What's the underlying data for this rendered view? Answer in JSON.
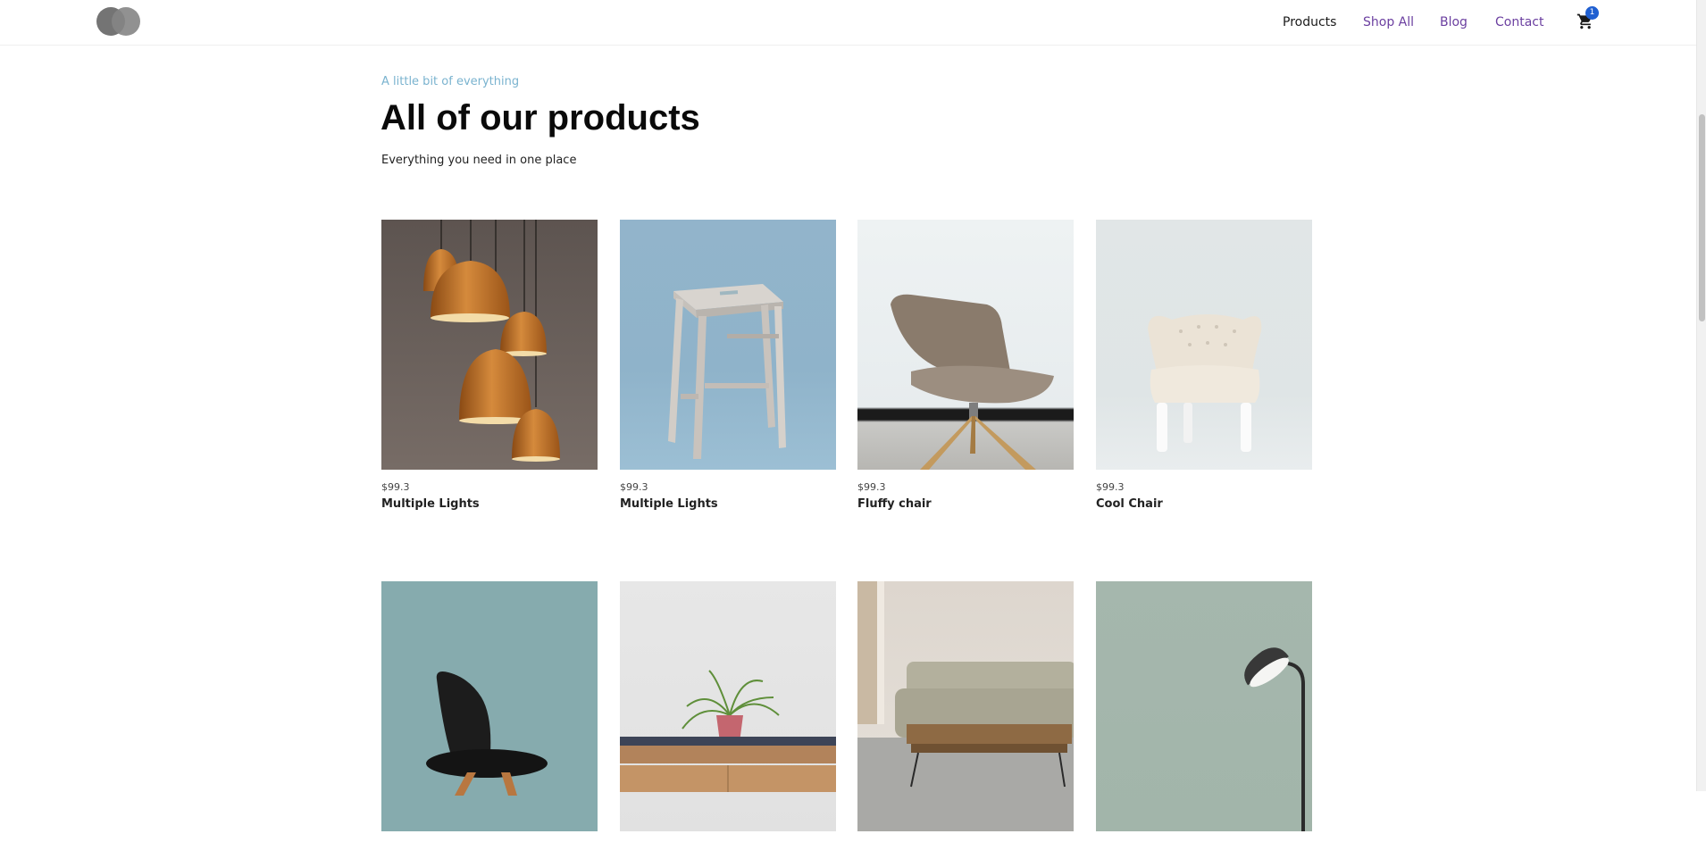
{
  "header": {
    "nav": [
      {
        "label": "Products",
        "active": true
      },
      {
        "label": "Shop All"
      },
      {
        "label": "Blog"
      },
      {
        "label": "Contact"
      }
    ],
    "cart_count": "1",
    "icons": {
      "logo": "overlapping-circles-logo",
      "cart": "shopping-cart-icon"
    }
  },
  "intro": {
    "eyebrow": "A little bit of everything",
    "title": "All of our products",
    "subtitle": "Everything you need in one place"
  },
  "products": [
    {
      "price": "$99.3",
      "name": "Multiple Lights"
    },
    {
      "price": "$99.3",
      "name": "Multiple Lights"
    },
    {
      "price": "$99.3",
      "name": "Fluffy chair"
    },
    {
      "price": "$99.3",
      "name": "Cool Chair"
    },
    {
      "price": "",
      "name": ""
    },
    {
      "price": "",
      "name": ""
    },
    {
      "price": "",
      "name": ""
    },
    {
      "price": "",
      "name": ""
    }
  ],
  "colors": {
    "accent": "#6b3fa0",
    "eyebrow": "#7ab3cf",
    "badge": "#1f5fd1"
  }
}
